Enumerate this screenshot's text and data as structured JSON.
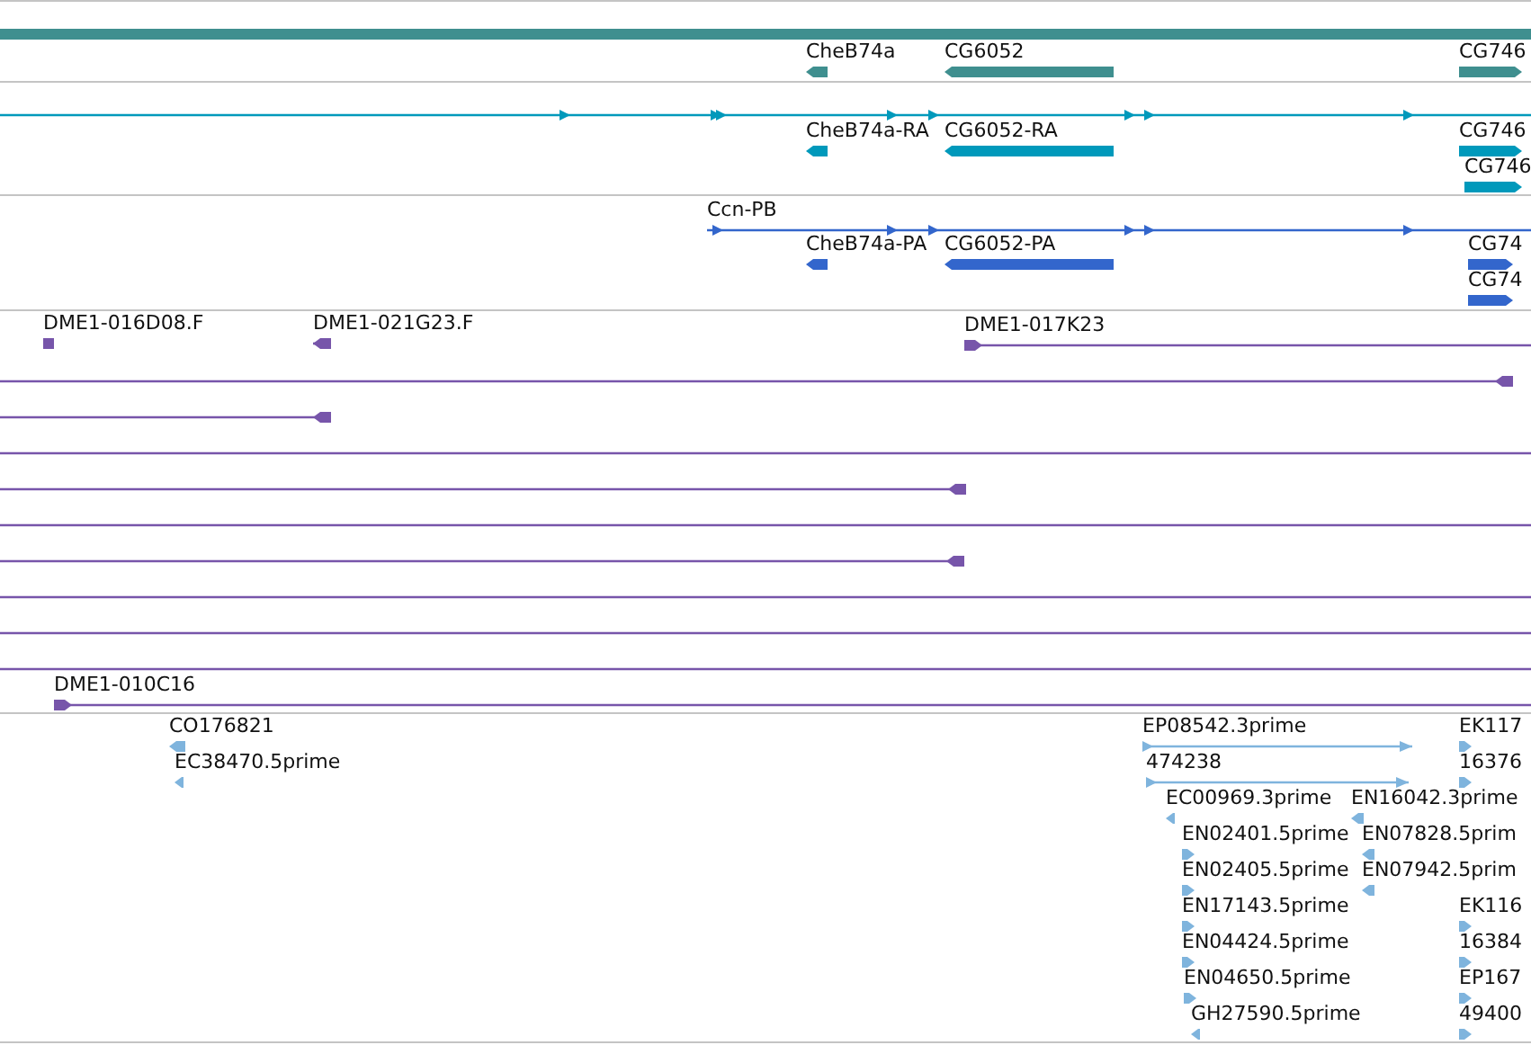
{
  "tracks": [
    {
      "kind": "gene",
      "color": "#3f8f8f",
      "features": [
        {
          "kind": "bar"
        },
        {
          "kind": "block",
          "label": "CheB74a",
          "reverse": true
        },
        {
          "kind": "block",
          "label": "CG6052",
          "reverse": true
        },
        {
          "kind": "block",
          "label": "CG746",
          "reverse": false
        }
      ]
    },
    {
      "kind": "transcript",
      "color": "#0099bb",
      "features": [
        {
          "kind": "line",
          "reverse": false
        },
        {
          "kind": "block",
          "label": "CheB74a-RA",
          "reverse": true
        },
        {
          "kind": "block",
          "label": "CG6052-RA",
          "reverse": true
        },
        {
          "kind": "block",
          "label": "CG746",
          "reverse": false
        },
        {
          "kind": "block",
          "label": "CG746",
          "reverse": false
        }
      ]
    },
    {
      "kind": "transcript",
      "color": "#3366cc",
      "features": [
        {
          "kind": "line",
          "label": "Ccn-PB",
          "reverse": false
        },
        {
          "kind": "block",
          "label": "CheB74a-PA",
          "reverse": true
        },
        {
          "kind": "block",
          "label": "CG6052-PA",
          "reverse": true
        },
        {
          "kind": "block",
          "label": "CG74",
          "reverse": false
        },
        {
          "kind": "block",
          "label": "CG74",
          "reverse": false
        }
      ]
    },
    {
      "kind": "clone",
      "color": "#7755aa",
      "features": [
        {
          "kind": "line",
          "label": "DME1-016D08.F",
          "reverse": true
        },
        {
          "kind": "line",
          "label": "DME1-021G23.F",
          "reverse": true
        },
        {
          "kind": "line",
          "label": "DME1-017K23",
          "reverse": false
        },
        {
          "kind": "line",
          "reverse": true
        },
        {
          "kind": "line",
          "reverse": true
        },
        {
          "kind": "line"
        },
        {
          "kind": "line",
          "reverse": true
        },
        {
          "kind": "line"
        },
        {
          "kind": "line",
          "reverse": true
        },
        {
          "kind": "line"
        },
        {
          "kind": "line"
        },
        {
          "kind": "line"
        },
        {
          "kind": "line",
          "label": "DME1-010C16",
          "reverse": false
        }
      ]
    },
    {
      "kind": "est",
      "color": "#7fb4dd",
      "features": [
        {
          "kind": "block",
          "label": "CO176821",
          "reverse": true
        },
        {
          "kind": "block",
          "label": "EC38470.5prime",
          "reverse": true
        },
        {
          "kind": "line",
          "label": "EP08542.3prime",
          "reverse": false
        },
        {
          "kind": "line",
          "label": "474238",
          "reverse": false
        },
        {
          "kind": "block",
          "label": "EC00969.3prime",
          "reverse": true
        },
        {
          "kind": "block",
          "label": "EN16042.3prime",
          "reverse": true
        },
        {
          "kind": "block",
          "label": "EN02401.5prime",
          "reverse": false
        },
        {
          "kind": "block",
          "label": "EN07828.5prim",
          "reverse": true
        },
        {
          "kind": "block",
          "label": "EN02405.5prime",
          "reverse": false
        },
        {
          "kind": "block",
          "label": "EN07942.5prim",
          "reverse": true
        },
        {
          "kind": "block",
          "label": "EN17143.5prime",
          "reverse": false
        },
        {
          "kind": "block",
          "label": "EN04424.5prime",
          "reverse": false
        },
        {
          "kind": "block",
          "label": "EN04650.5prime",
          "reverse": false
        },
        {
          "kind": "block",
          "label": "GH27590.5prime",
          "reverse": true
        },
        {
          "kind": "block",
          "label": "EK117",
          "reverse": false
        },
        {
          "kind": "block",
          "label": "16376",
          "reverse": false
        },
        {
          "kind": "block",
          "label": "EK116",
          "reverse": false
        },
        {
          "kind": "block",
          "label": "16384",
          "reverse": false
        },
        {
          "kind": "block",
          "label": "EP167",
          "reverse": false
        },
        {
          "kind": "block",
          "label": "49400",
          "reverse": false
        }
      ]
    }
  ]
}
